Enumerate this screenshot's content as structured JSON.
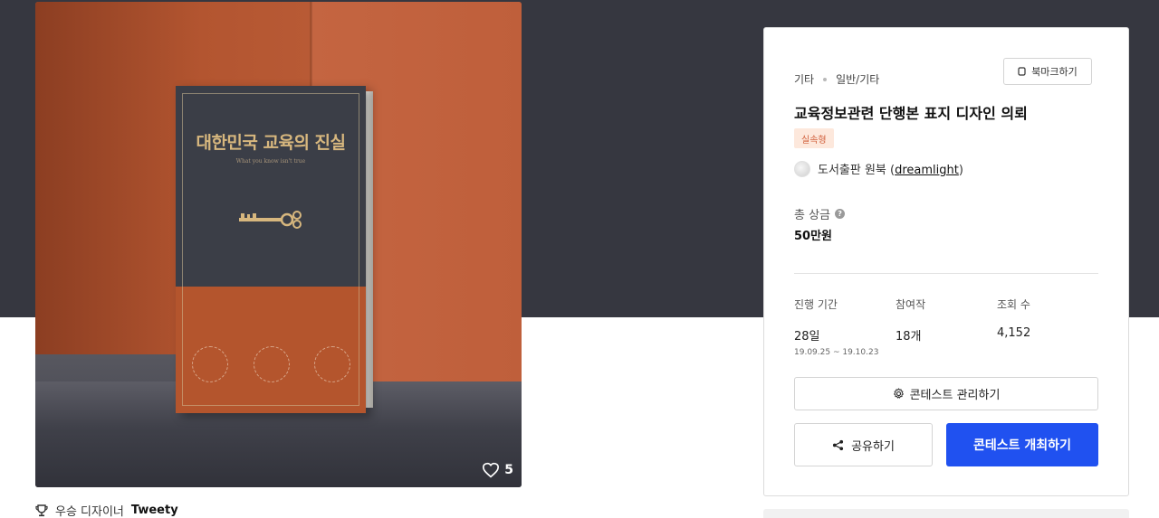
{
  "entry": {
    "likes": "5",
    "book": {
      "title": "대한민국 교육의 진실",
      "subtitle": "What you know isn't true"
    },
    "winner_label": "우승 디자이너",
    "winner_name": "Tweety"
  },
  "panel": {
    "breadcrumb": [
      "기타",
      "일반/기타"
    ],
    "bookmark_label": "북마크하기",
    "title": "교육정보관련 단행본 표지 디자인 의뢰",
    "badge": "실속형",
    "host_name": "도서출판 원북 (",
    "host_handle": "dreamlight",
    "host_suffix": ")",
    "prize_label": "총 상금",
    "prize_value": "50만원",
    "stats": {
      "period_label": "진행 기간",
      "period_value": "28일",
      "period_range": "19.09.25 ~ 19.10.23",
      "participants_label": "참여작",
      "participants_value": "18개",
      "views_label": "조회 수",
      "views_value": "4,152"
    },
    "manage_label": "콘테스트 관리하기",
    "share_label": "공유하기",
    "host_contest_label": "콘테스트 개최하기"
  },
  "colors": {
    "top_band": "#363740",
    "primary": "#2051f0",
    "badge_bg": "#fde8dc",
    "badge_text": "#d1603c"
  }
}
